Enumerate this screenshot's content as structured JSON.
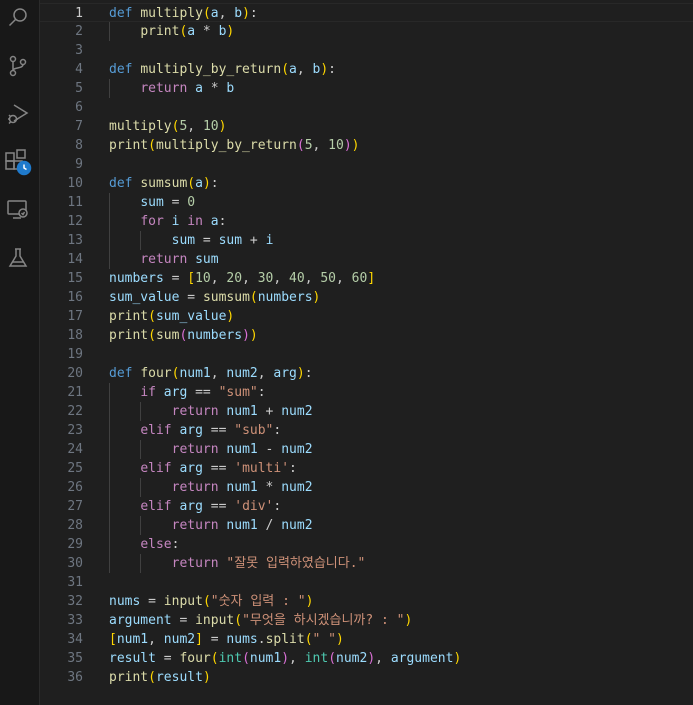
{
  "activity_bar": {
    "icons": [
      "search-icon",
      "source-control-icon",
      "run-debug-icon",
      "extensions-icon",
      "remote-explorer-icon",
      "testing-icon"
    ]
  },
  "editor": {
    "active_line": 1,
    "lines": [
      {
        "n": "1",
        "tokens": [
          [
            "kw",
            "def"
          ],
          [
            "op",
            " "
          ],
          [
            "fn",
            "multiply"
          ],
          [
            "br1",
            "("
          ],
          [
            "var",
            "a"
          ],
          [
            "op",
            ", "
          ],
          [
            "var",
            "b"
          ],
          [
            "br1",
            ")"
          ],
          [
            "op",
            ":"
          ]
        ]
      },
      {
        "n": "2",
        "tokens": [
          [
            "op",
            "    "
          ],
          [
            "fn",
            "print"
          ],
          [
            "br1",
            "("
          ],
          [
            "var",
            "a"
          ],
          [
            "op",
            " * "
          ],
          [
            "var",
            "b"
          ],
          [
            "br1",
            ")"
          ]
        ]
      },
      {
        "n": "3",
        "tokens": []
      },
      {
        "n": "4",
        "tokens": [
          [
            "kw",
            "def"
          ],
          [
            "op",
            " "
          ],
          [
            "fn",
            "multiply_by_return"
          ],
          [
            "br1",
            "("
          ],
          [
            "var",
            "a"
          ],
          [
            "op",
            ", "
          ],
          [
            "var",
            "b"
          ],
          [
            "br1",
            ")"
          ],
          [
            "op",
            ":"
          ]
        ]
      },
      {
        "n": "5",
        "tokens": [
          [
            "op",
            "    "
          ],
          [
            "ctl",
            "return"
          ],
          [
            "op",
            " "
          ],
          [
            "var",
            "a"
          ],
          [
            "op",
            " * "
          ],
          [
            "var",
            "b"
          ]
        ]
      },
      {
        "n": "6",
        "tokens": []
      },
      {
        "n": "7",
        "tokens": [
          [
            "fn",
            "multiply"
          ],
          [
            "br1",
            "("
          ],
          [
            "num",
            "5"
          ],
          [
            "op",
            ", "
          ],
          [
            "num",
            "10"
          ],
          [
            "br1",
            ")"
          ]
        ]
      },
      {
        "n": "8",
        "tokens": [
          [
            "fn",
            "print"
          ],
          [
            "br1",
            "("
          ],
          [
            "fn",
            "multiply_by_return"
          ],
          [
            "br2",
            "("
          ],
          [
            "num",
            "5"
          ],
          [
            "op",
            ", "
          ],
          [
            "num",
            "10"
          ],
          [
            "br2",
            ")"
          ],
          [
            "br1",
            ")"
          ]
        ]
      },
      {
        "n": "9",
        "tokens": []
      },
      {
        "n": "10",
        "tokens": [
          [
            "kw",
            "def"
          ],
          [
            "op",
            " "
          ],
          [
            "fn",
            "sumsum"
          ],
          [
            "br1",
            "("
          ],
          [
            "var",
            "a"
          ],
          [
            "br1",
            ")"
          ],
          [
            "op",
            ":"
          ]
        ]
      },
      {
        "n": "11",
        "tokens": [
          [
            "op",
            "    "
          ],
          [
            "var",
            "sum"
          ],
          [
            "op",
            " = "
          ],
          [
            "num",
            "0"
          ]
        ]
      },
      {
        "n": "12",
        "tokens": [
          [
            "op",
            "    "
          ],
          [
            "ctl",
            "for"
          ],
          [
            "op",
            " "
          ],
          [
            "var",
            "i"
          ],
          [
            "op",
            " "
          ],
          [
            "ctl",
            "in"
          ],
          [
            "op",
            " "
          ],
          [
            "var",
            "a"
          ],
          [
            "op",
            ":"
          ]
        ]
      },
      {
        "n": "13",
        "tokens": [
          [
            "op",
            "        "
          ],
          [
            "var",
            "sum"
          ],
          [
            "op",
            " = "
          ],
          [
            "var",
            "sum"
          ],
          [
            "op",
            " + "
          ],
          [
            "var",
            "i"
          ]
        ]
      },
      {
        "n": "14",
        "tokens": [
          [
            "op",
            "    "
          ],
          [
            "ctl",
            "return"
          ],
          [
            "op",
            " "
          ],
          [
            "var",
            "sum"
          ]
        ]
      },
      {
        "n": "15",
        "tokens": [
          [
            "var",
            "numbers"
          ],
          [
            "op",
            " = "
          ],
          [
            "br1",
            "["
          ],
          [
            "num",
            "10"
          ],
          [
            "op",
            ", "
          ],
          [
            "num",
            "20"
          ],
          [
            "op",
            ", "
          ],
          [
            "num",
            "30"
          ],
          [
            "op",
            ", "
          ],
          [
            "num",
            "40"
          ],
          [
            "op",
            ", "
          ],
          [
            "num",
            "50"
          ],
          [
            "op",
            ", "
          ],
          [
            "num",
            "60"
          ],
          [
            "br1",
            "]"
          ]
        ]
      },
      {
        "n": "16",
        "tokens": [
          [
            "var",
            "sum_value"
          ],
          [
            "op",
            " = "
          ],
          [
            "fn",
            "sumsum"
          ],
          [
            "br1",
            "("
          ],
          [
            "var",
            "numbers"
          ],
          [
            "br1",
            ")"
          ]
        ]
      },
      {
        "n": "17",
        "tokens": [
          [
            "fn",
            "print"
          ],
          [
            "br1",
            "("
          ],
          [
            "var",
            "sum_value"
          ],
          [
            "br1",
            ")"
          ]
        ]
      },
      {
        "n": "18",
        "tokens": [
          [
            "fn",
            "print"
          ],
          [
            "br1",
            "("
          ],
          [
            "fn",
            "sum"
          ],
          [
            "br2",
            "("
          ],
          [
            "var",
            "numbers"
          ],
          [
            "br2",
            ")"
          ],
          [
            "br1",
            ")"
          ]
        ]
      },
      {
        "n": "19",
        "tokens": []
      },
      {
        "n": "20",
        "tokens": [
          [
            "kw",
            "def"
          ],
          [
            "op",
            " "
          ],
          [
            "fn",
            "four"
          ],
          [
            "br1",
            "("
          ],
          [
            "var",
            "num1"
          ],
          [
            "op",
            ", "
          ],
          [
            "var",
            "num2"
          ],
          [
            "op",
            ", "
          ],
          [
            "var",
            "arg"
          ],
          [
            "br1",
            ")"
          ],
          [
            "op",
            ":"
          ]
        ]
      },
      {
        "n": "21",
        "tokens": [
          [
            "op",
            "    "
          ],
          [
            "ctl",
            "if"
          ],
          [
            "op",
            " "
          ],
          [
            "var",
            "arg"
          ],
          [
            "op",
            " == "
          ],
          [
            "str",
            "\"sum\""
          ],
          [
            "op",
            ":"
          ]
        ]
      },
      {
        "n": "22",
        "tokens": [
          [
            "op",
            "        "
          ],
          [
            "ctl",
            "return"
          ],
          [
            "op",
            " "
          ],
          [
            "var",
            "num1"
          ],
          [
            "op",
            " + "
          ],
          [
            "var",
            "num2"
          ]
        ]
      },
      {
        "n": "23",
        "tokens": [
          [
            "op",
            "    "
          ],
          [
            "ctl",
            "elif"
          ],
          [
            "op",
            " "
          ],
          [
            "var",
            "arg"
          ],
          [
            "op",
            " == "
          ],
          [
            "str",
            "\"sub\""
          ],
          [
            "op",
            ":"
          ]
        ]
      },
      {
        "n": "24",
        "tokens": [
          [
            "op",
            "        "
          ],
          [
            "ctl",
            "return"
          ],
          [
            "op",
            " "
          ],
          [
            "var",
            "num1"
          ],
          [
            "op",
            " - "
          ],
          [
            "var",
            "num2"
          ]
        ]
      },
      {
        "n": "25",
        "tokens": [
          [
            "op",
            "    "
          ],
          [
            "ctl",
            "elif"
          ],
          [
            "op",
            " "
          ],
          [
            "var",
            "arg"
          ],
          [
            "op",
            " == "
          ],
          [
            "str",
            "'multi'"
          ],
          [
            "op",
            ":"
          ]
        ]
      },
      {
        "n": "26",
        "tokens": [
          [
            "op",
            "        "
          ],
          [
            "ctl",
            "return"
          ],
          [
            "op",
            " "
          ],
          [
            "var",
            "num1"
          ],
          [
            "op",
            " * "
          ],
          [
            "var",
            "num2"
          ]
        ]
      },
      {
        "n": "27",
        "tokens": [
          [
            "op",
            "    "
          ],
          [
            "ctl",
            "elif"
          ],
          [
            "op",
            " "
          ],
          [
            "var",
            "arg"
          ],
          [
            "op",
            " == "
          ],
          [
            "str",
            "'div'"
          ],
          [
            "op",
            ":"
          ]
        ]
      },
      {
        "n": "28",
        "tokens": [
          [
            "op",
            "        "
          ],
          [
            "ctl",
            "return"
          ],
          [
            "op",
            " "
          ],
          [
            "var",
            "num1"
          ],
          [
            "op",
            " / "
          ],
          [
            "var",
            "num2"
          ]
        ]
      },
      {
        "n": "29",
        "tokens": [
          [
            "op",
            "    "
          ],
          [
            "ctl",
            "else"
          ],
          [
            "op",
            ":"
          ]
        ]
      },
      {
        "n": "30",
        "tokens": [
          [
            "op",
            "        "
          ],
          [
            "ctl",
            "return"
          ],
          [
            "op",
            " "
          ],
          [
            "str",
            "\"잘못 입력하였습니다.\""
          ]
        ]
      },
      {
        "n": "31",
        "tokens": []
      },
      {
        "n": "32",
        "tokens": [
          [
            "var",
            "nums"
          ],
          [
            "op",
            " = "
          ],
          [
            "fn",
            "input"
          ],
          [
            "br1",
            "("
          ],
          [
            "str",
            "\"숫자 입력 : \""
          ],
          [
            "br1",
            ")"
          ]
        ]
      },
      {
        "n": "33",
        "tokens": [
          [
            "var",
            "argument"
          ],
          [
            "op",
            " = "
          ],
          [
            "fn",
            "input"
          ],
          [
            "br1",
            "("
          ],
          [
            "str",
            "\"무엇을 하시겠습니까? : \""
          ],
          [
            "br1",
            ")"
          ]
        ]
      },
      {
        "n": "34",
        "tokens": [
          [
            "br1",
            "["
          ],
          [
            "var",
            "num1"
          ],
          [
            "op",
            ", "
          ],
          [
            "var",
            "num2"
          ],
          [
            "br1",
            "]"
          ],
          [
            "op",
            " = "
          ],
          [
            "var",
            "nums"
          ],
          [
            "op",
            "."
          ],
          [
            "fn",
            "split"
          ],
          [
            "br1",
            "("
          ],
          [
            "str",
            "\" \""
          ],
          [
            "br1",
            ")"
          ]
        ]
      },
      {
        "n": "35",
        "tokens": [
          [
            "var",
            "result"
          ],
          [
            "op",
            " = "
          ],
          [
            "fn",
            "four"
          ],
          [
            "br1",
            "("
          ],
          [
            "cls",
            "int"
          ],
          [
            "br2",
            "("
          ],
          [
            "var",
            "num1"
          ],
          [
            "br2",
            ")"
          ],
          [
            "op",
            ", "
          ],
          [
            "cls",
            "int"
          ],
          [
            "br2",
            "("
          ],
          [
            "var",
            "num2"
          ],
          [
            "br2",
            ")"
          ],
          [
            "op",
            ", "
          ],
          [
            "var",
            "argument"
          ],
          [
            "br1",
            ")"
          ]
        ]
      },
      {
        "n": "36",
        "tokens": [
          [
            "fn",
            "print"
          ],
          [
            "br1",
            "("
          ],
          [
            "var",
            "result"
          ],
          [
            "br1",
            ")"
          ]
        ]
      }
    ]
  }
}
